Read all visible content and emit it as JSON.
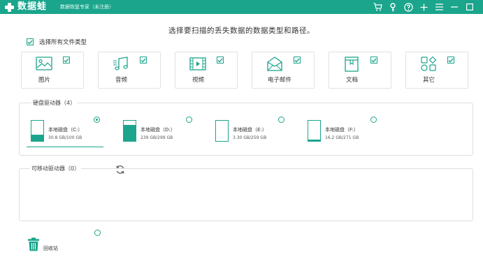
{
  "titlebar": {
    "app_name": "数据蛙",
    "subtitle": "数据恢复专家（未注册）",
    "icons": [
      "cart-icon",
      "key-icon",
      "help-icon",
      "plus-icon",
      "menu-icon",
      "minimize-icon",
      "close-icon"
    ]
  },
  "header": {
    "title": "选择要扫描的丢失数据的数据类型和路径。",
    "select_all_label": "选择所有文件类型",
    "select_all_checked": true
  },
  "types": [
    {
      "label": "图片",
      "icon": "image-icon",
      "checked": true
    },
    {
      "label": "音频",
      "icon": "music-icon",
      "checked": true
    },
    {
      "label": "视频",
      "icon": "video-icon",
      "checked": true
    },
    {
      "label": "电子邮件",
      "icon": "email-icon",
      "checked": true
    },
    {
      "label": "文档",
      "icon": "document-icon",
      "checked": true
    },
    {
      "label": "其它",
      "icon": "other-icon",
      "checked": true
    }
  ],
  "hard_drives": {
    "title": "硬盘驱动器（4）",
    "drives": [
      {
        "name": "本地磁盘（C:）",
        "size": "30.8 GB/100 GB",
        "used_fraction": 0.31,
        "selected": true
      },
      {
        "name": "本地磁盘（D:）",
        "size": "239 GB/299 GB",
        "used_fraction": 0.8,
        "selected": false
      },
      {
        "name": "本地磁盘（E:）",
        "size": "3.30 GB/259 GB",
        "used_fraction": 0.013,
        "selected": false
      },
      {
        "name": "本地磁盘（F:）",
        "size": "16.2 GB/271 GB",
        "used_fraction": 0.06,
        "selected": false
      }
    ]
  },
  "removable": {
    "title": "可移动驱动器（0）"
  },
  "recycle_bin": {
    "label": "回收站",
    "selected": false
  },
  "colors": {
    "accent": "#1aa58c",
    "border": "#dedede"
  }
}
